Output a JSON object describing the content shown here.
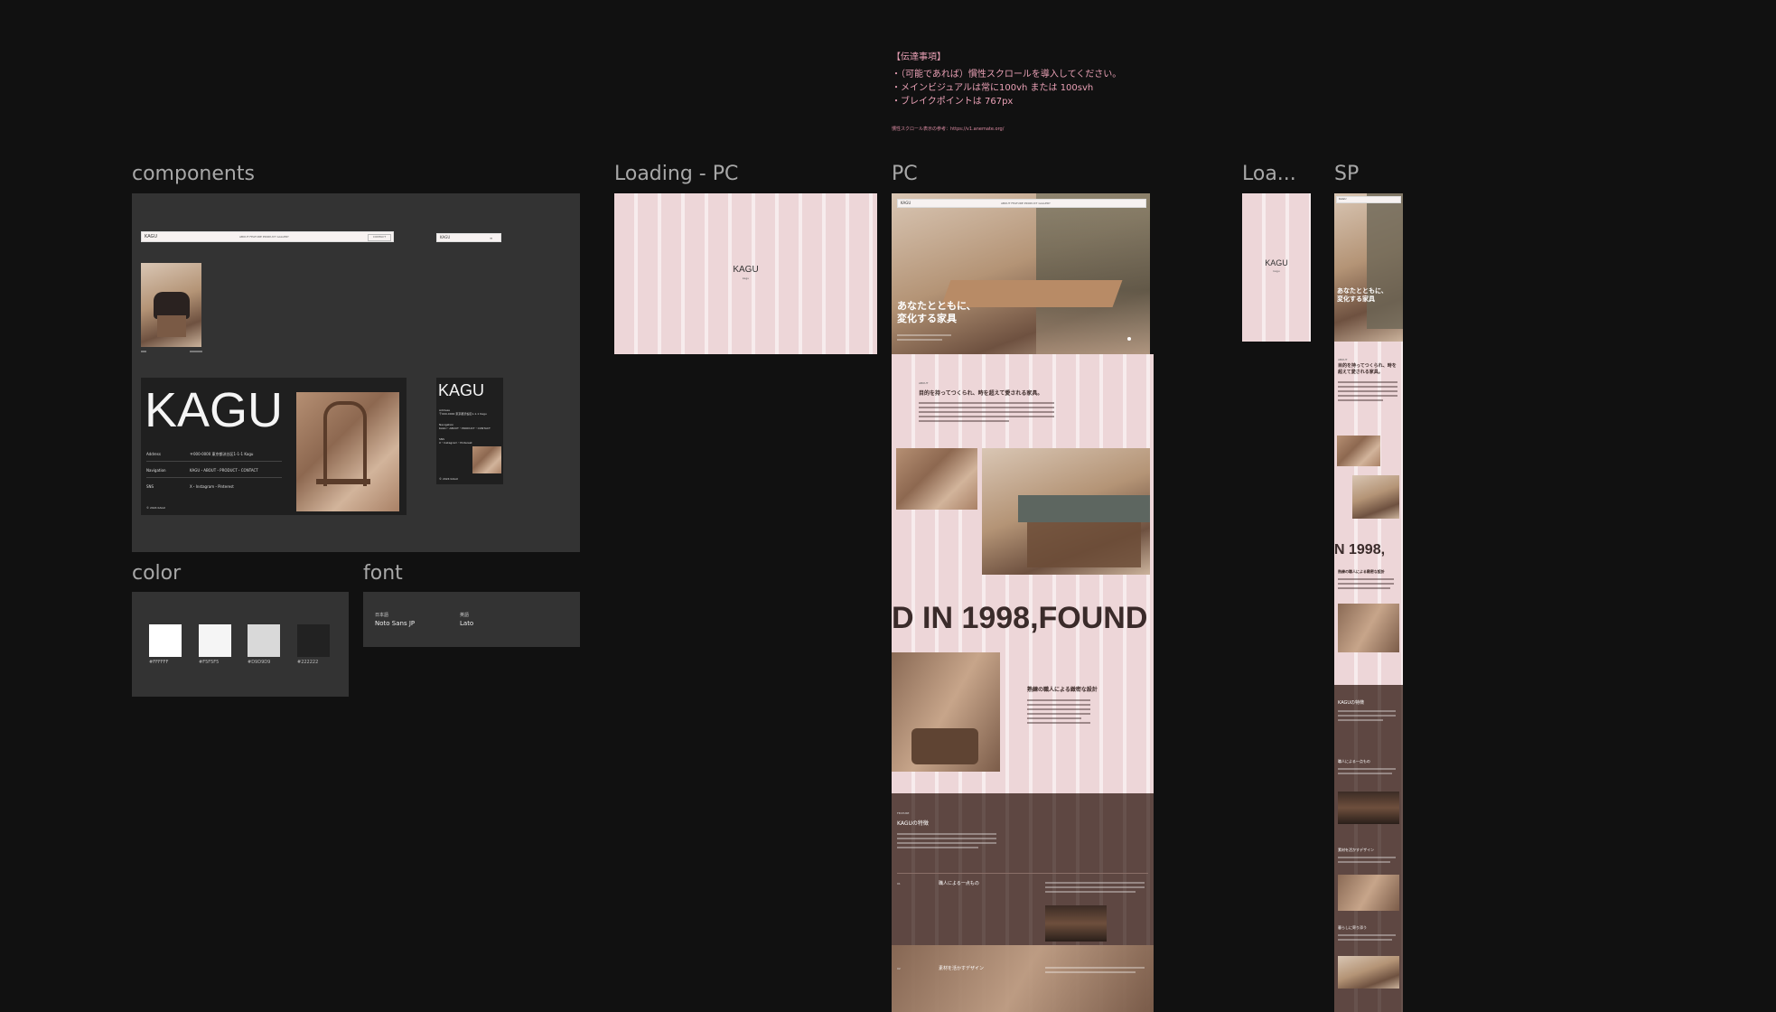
{
  "notes": {
    "title": "【伝達事項】",
    "items": [
      "・（可能であれば）慣性スクロールを導入してください。",
      "・メインビジュアルは常に100vh または 100svh",
      "・ブレイクポイントは 767px"
    ],
    "ref": "慣性スクロール表示の参考：https://v1.anemate.org/"
  },
  "frames": {
    "components": "components",
    "loading_pc": "Loading - PC",
    "pc": "PC",
    "loading_sp": "Loa...",
    "sp": "SP",
    "color": "color",
    "font": "font"
  },
  "brand": "KAGU",
  "loading_sub": "kagu",
  "components": {
    "nav_items": "ABOUT  FEATURE  PRODUCT  GALLERY",
    "nav_btn": "CONTACT",
    "sp_nav_logo": "KAGU",
    "footer": {
      "rows": [
        {
          "label": "Address",
          "value": "〒000-0000 東京都渋谷区1-1-1 Kagu"
        },
        {
          "label": "Navigation",
          "value": "KAGU・ABOUT・PRODUCT・CONTACT"
        },
        {
          "label": "SNS",
          "value": "X・Instagram・Pinterest"
        }
      ],
      "copy": "© 2024 KAGU"
    }
  },
  "colors": [
    {
      "hex": "#FFFFFF",
      "label": "#FFFFFF"
    },
    {
      "hex": "#F5F5F5",
      "label": "#F5F5F5"
    },
    {
      "hex": "#D9D9D9",
      "label": "#D9D9D9"
    },
    {
      "hex": "#222222",
      "label": "#222222"
    }
  ],
  "fonts": {
    "ja_label": "日本語",
    "ja_name": "Noto Sans JP",
    "en_label": "英語",
    "en_name": "Lato"
  },
  "pc": {
    "hero_title_1": "あなたとともに、",
    "hero_title_2": "変化する家具",
    "about_label": "ABOUT",
    "about_title": "目的を持ってつくられ、時を超えて愛される家具。",
    "marquee": "D IN 1998,FOUND",
    "craft_title": "熟練の職人による緻密な設計",
    "feature_label": "FEATURE",
    "feature_title": "KAGUの特徴",
    "feat1": "職人による一点もの",
    "feat2": "素材を活かすデザイン",
    "feat1_no": "01",
    "feat2_no": "02"
  },
  "sp": {
    "hero_title_1": "あなたとともに、",
    "hero_title_2": "変化する家具",
    "about_label": "ABOUT",
    "about_title": "目的を持ってつくられ、時を超えて愛される家具。",
    "marquee": "N 1998,",
    "craft_title": "熟練の職人による緻密な設計",
    "feature_title": "KAGUの特徴",
    "feat1": "職人による一点もの",
    "feat2": "素材を活かすデザイン",
    "feat3": "暮らしに寄り添う"
  }
}
